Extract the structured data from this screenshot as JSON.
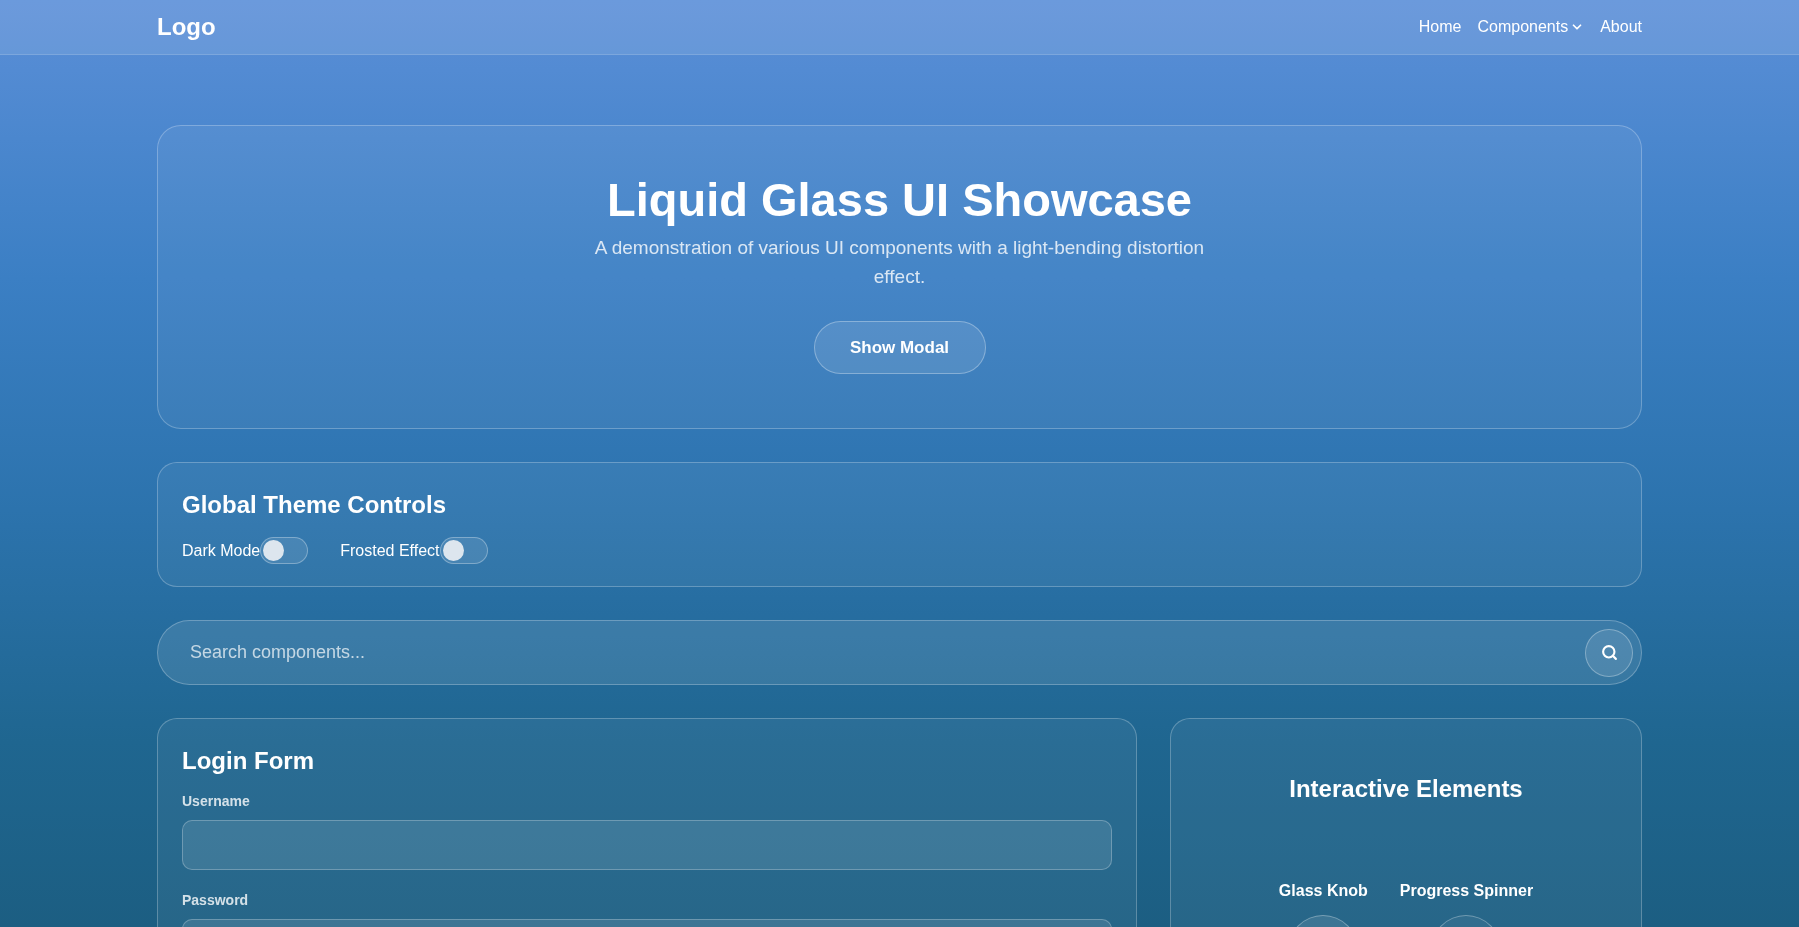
{
  "nav": {
    "logo": "Logo",
    "links": [
      {
        "label": "Home",
        "dropdown": false
      },
      {
        "label": "Components",
        "dropdown": true
      },
      {
        "label": "About",
        "dropdown": false
      }
    ]
  },
  "hero": {
    "title": "Liquid Glass UI Showcase",
    "subtitle": "A demonstration of various UI components with a light-bending distortion effect.",
    "button": "Show Modal"
  },
  "theme_controls": {
    "title": "Global Theme Controls",
    "toggles": [
      {
        "label": "Dark Mode",
        "on": false
      },
      {
        "label": "Frosted Effect",
        "on": false
      }
    ]
  },
  "search": {
    "placeholder": "Search components..."
  },
  "login_form": {
    "title": "Login Form",
    "fields": [
      {
        "label": "Username"
      },
      {
        "label": "Password"
      }
    ]
  },
  "interactive": {
    "title": "Interactive Elements",
    "items": [
      {
        "label": "Glass Knob",
        "kind": "knob"
      },
      {
        "label": "Progress Spinner",
        "kind": "spinner"
      }
    ]
  }
}
